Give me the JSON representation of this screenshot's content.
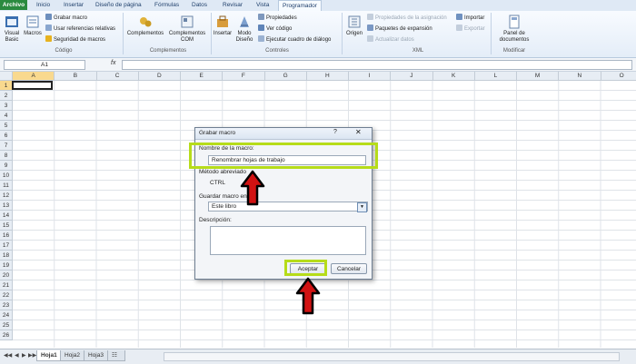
{
  "ribbon_tabs": [
    "Archivo",
    "Inicio",
    "Insertar",
    "Diseño de página",
    "Fórmulas",
    "Datos",
    "Revisar",
    "Vista",
    "Programador"
  ],
  "ribbon": {
    "codigo": {
      "visual_basic": "Visual\nBasic",
      "macros": "Macros",
      "grabar_macro": "Grabar macro",
      "usar_referencias": "Usar referencias relativas",
      "seguridad": "Seguridad de macros",
      "label": "Código"
    },
    "complementos": {
      "complementos": "Complementos",
      "complementos_com": "Complementos\nCOM",
      "label": "Complementos"
    },
    "controles": {
      "insertar": "Insertar",
      "modo_diseno": "Modo\nDiseño",
      "propiedades": "Propiedades",
      "ver_codigo": "Ver código",
      "ejecutar_cuadro": "Ejecutar cuadro de diálogo",
      "label": "Controles"
    },
    "xml": {
      "origen": "Origen",
      "propiedades_asignacion": "Propiedades de la asignación",
      "paquetes_expansion": "Paquetes de expansión",
      "actualizar_datos": "Actualizar datos",
      "importar": "Importar",
      "exportar": "Exportar",
      "label": "XML"
    },
    "modificar": {
      "panel_documentos": "Panel de\ndocumentos",
      "label": "Modificar"
    }
  },
  "formula_bar": {
    "name_box": "A1",
    "fx": "fx",
    "value": ""
  },
  "columns": [
    "A",
    "B",
    "C",
    "D",
    "E",
    "F",
    "G",
    "H",
    "I",
    "J",
    "K",
    "L",
    "M",
    "N",
    "O"
  ],
  "rows": [
    "1",
    "2",
    "3",
    "4",
    "5",
    "6",
    "7",
    "8",
    "9",
    "10",
    "11",
    "12",
    "13",
    "14",
    "15",
    "16",
    "17",
    "18",
    "19",
    "20",
    "21",
    "22",
    "23",
    "24",
    "25",
    "26"
  ],
  "sheet_tabs": [
    "Hoja1",
    "Hoja2",
    "Hoja3"
  ],
  "dialog": {
    "title": "Grabar macro",
    "help_glyph": "?",
    "close_glyph": "✕",
    "macro_name_label": "Nombre de la macro:",
    "macro_name_value": "Renombrar hojas de trabajo",
    "shortcut_label": "Método abreviado",
    "shortcut_prefix": "CTRL",
    "store_label": "Guardar macro en",
    "store_value": "Este libro",
    "description_label": "Descripción:",
    "description_value": "",
    "ok_button": "Aceptar",
    "cancel_button": "Cancelar"
  },
  "colors": {
    "highlight": "#b6dc1a",
    "arrow_fill": "#d11212",
    "arrow_outline": "#000000",
    "file_tab": "#2a8a3f"
  }
}
